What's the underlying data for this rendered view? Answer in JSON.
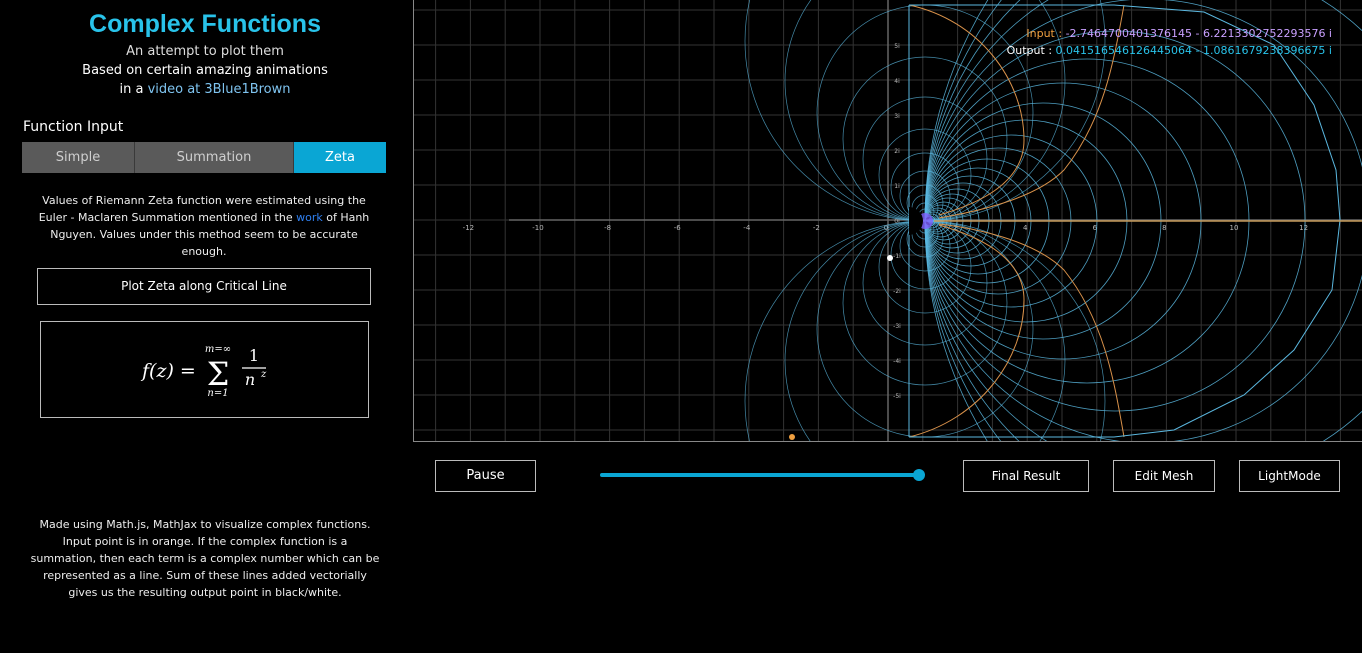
{
  "sidebar": {
    "title": "Complex Functions",
    "subtitle1": "An attempt to plot them",
    "subtitle2": "Based on certain amazing animations",
    "subtitle3_pre": "in a",
    "subtitle3_link": "video at 3Blue1Brown",
    "function_input_label": "Function Input",
    "tabs": [
      {
        "label": "Simple",
        "active": false
      },
      {
        "label": "Summation",
        "active": false
      },
      {
        "label": "Zeta",
        "active": true
      }
    ],
    "description_pre": "Values of Riemann Zeta function were estimated using the Euler - Maclaren Summation mentioned in the",
    "description_link": "work",
    "description_post": "of Hanh Nguyen. Values under this method seem to be accurate enough.",
    "plot_button_label": "Plot Zeta along Critical Line",
    "formula": {
      "lhs": "f(z) =",
      "sum_upper": "m=∞",
      "sum_symbol": "Σ",
      "sum_lower": "n=1",
      "numerator": "1",
      "denominator_base": "n",
      "denominator_exp": "z"
    },
    "footer": "Made using Math.js, MathJax to visualize complex functions. Input point is in orange. If the complex function is a summation, then each term is a complex number which can be represented as a line. Sum of these lines added vectorially gives us the resulting output point in black/white."
  },
  "plot": {
    "input_label": "Input :",
    "input_value": "-2.7464700401376145 - 6.2213302752293576 i",
    "output_label": "Output :",
    "output_value": "0.041516546126445064 - 1.0861679238396675 i",
    "x_ticks": [
      "-12",
      "-10",
      "-8",
      "-6",
      "-4",
      "-2",
      "0",
      "2",
      "4",
      "6",
      "8",
      "10",
      "12"
    ],
    "y_ticks": [
      "5i",
      "4i",
      "3i",
      "2i",
      "1i",
      "0i",
      "-1i",
      "-2i",
      "-3i",
      "-4i",
      "-5i"
    ],
    "colors": {
      "input": "#f0a040",
      "output": "#29c3ea",
      "mesh_blue": "#5bb8e0",
      "mesh_orange": "#d8914a",
      "grid": "#333333",
      "accent": "#0aa6d4"
    }
  },
  "controls": {
    "pause_label": "Pause",
    "slider_value": 1.0,
    "final_result_label": "Final Result",
    "edit_mesh_label": "Edit Mesh",
    "light_mode_label": "LightMode"
  }
}
